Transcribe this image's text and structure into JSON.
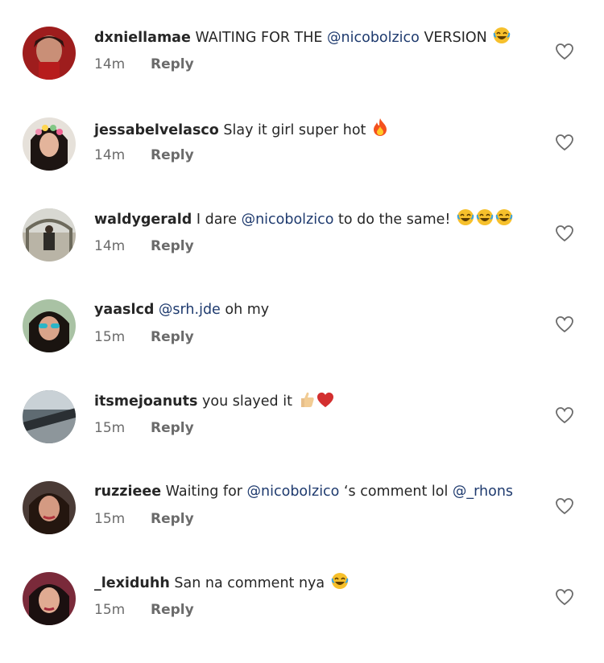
{
  "reply_label": "Reply",
  "comments": [
    {
      "username": "dxniellamae",
      "before": "WAITING FOR THE ",
      "mention": "@nicobolzico",
      "after": "  VERSION",
      "emoji": [
        "laugh"
      ],
      "time": "14m"
    },
    {
      "username": "jessabelvelasco",
      "before": "Slay it girl super hot",
      "mention": "",
      "after": "",
      "emoji": [
        "fire"
      ],
      "time": "14m"
    },
    {
      "username": "waldygerald",
      "before": "I dare  ",
      "mention": "@nicobolzico",
      "after": " to do the same! ",
      "emoji": [
        "laugh",
        "laugh",
        "laugh"
      ],
      "time": "14m"
    },
    {
      "username": "yaaslcd",
      "before": "",
      "mention": "@srh.jde",
      "after": " oh my",
      "emoji": [],
      "time": "15m"
    },
    {
      "username": "itsmejoanuts",
      "before": "you slayed it ",
      "mention": "",
      "after": "",
      "emoji": [
        "thumbs-up",
        "heart"
      ],
      "time": "15m"
    },
    {
      "username": "ruzzieee",
      "before": "Waiting for ",
      "mention": "@nicobolzico",
      "after": " ‘s comment lol ",
      "mention2": "@_rhons",
      "emoji": [],
      "time": "15m"
    },
    {
      "username": "_lexiduhh",
      "before": "San na comment nya ",
      "mention": "",
      "after": "",
      "emoji": [
        "laugh"
      ],
      "time": "15m"
    }
  ],
  "colors": {
    "mention": "#1e3a6e",
    "meta": "#6b6b6b",
    "text": "#262626"
  }
}
